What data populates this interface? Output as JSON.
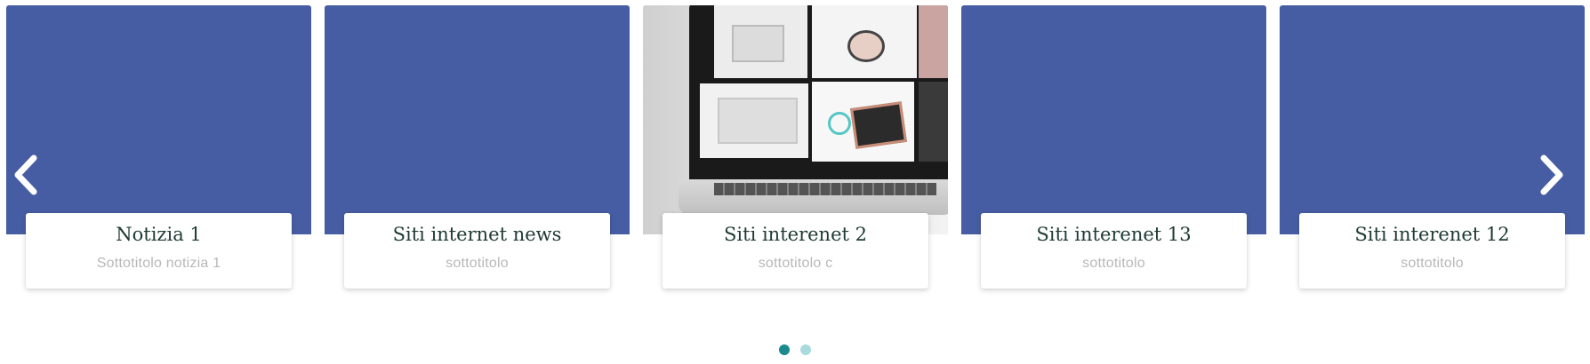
{
  "slides": [
    {
      "title": "Notizia 1",
      "subtitle": "Sottotitolo notizia 1",
      "image": "blue-placeholder"
    },
    {
      "title": "Siti internet news",
      "subtitle": "sottotitolo",
      "image": "blue-placeholder"
    },
    {
      "title": "Siti interenet 2",
      "subtitle": "sottotitolo c",
      "image": "laptop-collage-photo"
    },
    {
      "title": "Siti interenet 13",
      "subtitle": "sottotitolo",
      "image": "blue-placeholder"
    },
    {
      "title": "Siti interenet 12",
      "subtitle": "sottotitolo",
      "image": "blue-placeholder"
    }
  ],
  "controls": {
    "prev_icon": "chevron-left-icon",
    "next_icon": "chevron-right-icon"
  },
  "pagination": {
    "pages": 2,
    "active_page": 1
  },
  "colors": {
    "placeholder_blue": "#465da3",
    "title_text": "#1f3a33",
    "subtitle_text": "#b8b8b8",
    "dot_active": "#1a8a8f",
    "dot_inactive": "#a9dadd"
  }
}
